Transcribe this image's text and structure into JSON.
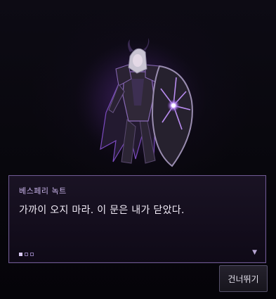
{
  "dialogue": {
    "speaker": "베스페리 녹트",
    "text": "가까이 오지 마라. 이 문은 내가 닫았다.",
    "page_current": 1,
    "page_total": 3,
    "next_indicator": "▼"
  },
  "controls": {
    "skip_label": "건너뛰기"
  },
  "colors": {
    "dialogue_border": "#6f5a92",
    "speaker_name": "#c9b4ea",
    "aura": "#8a3fd0"
  },
  "icons": {
    "next": "down-triangle-icon"
  }
}
